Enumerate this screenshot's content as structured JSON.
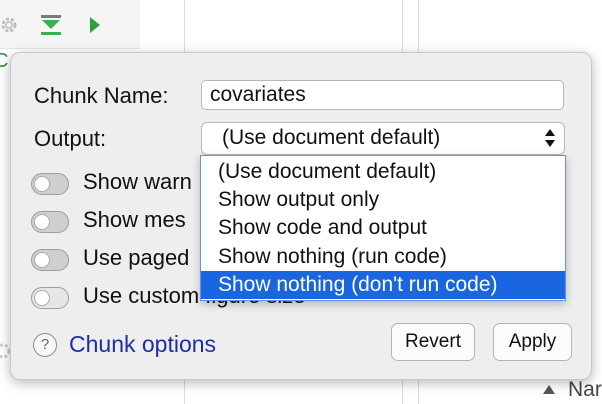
{
  "background": {
    "partial_letter": "C",
    "partial_label": "Nar"
  },
  "dialog": {
    "chunk_name_label": "Chunk Name:",
    "chunk_name_value": "covariates",
    "output_label": "Output:",
    "output_selected": "(Use document default)",
    "toggles": [
      {
        "label": "Show warn",
        "state": "on"
      },
      {
        "label": "Show mes",
        "state": "on"
      },
      {
        "label": "Use paged",
        "state": "on"
      },
      {
        "label": "Use custom figure size",
        "state": "off"
      }
    ],
    "help_symbol": "?",
    "help_link": "Chunk options",
    "revert_button": "Revert",
    "apply_button": "Apply"
  },
  "dropdown": {
    "options": [
      "(Use document default)",
      "Show output only",
      "Show code and output",
      "Show nothing (run code)",
      "Show nothing (don't run code)"
    ],
    "highlighted_index": 4
  },
  "colors": {
    "highlight": "#1a66e0",
    "link": "#1a2ea8",
    "run_icon": "#2ea043"
  }
}
